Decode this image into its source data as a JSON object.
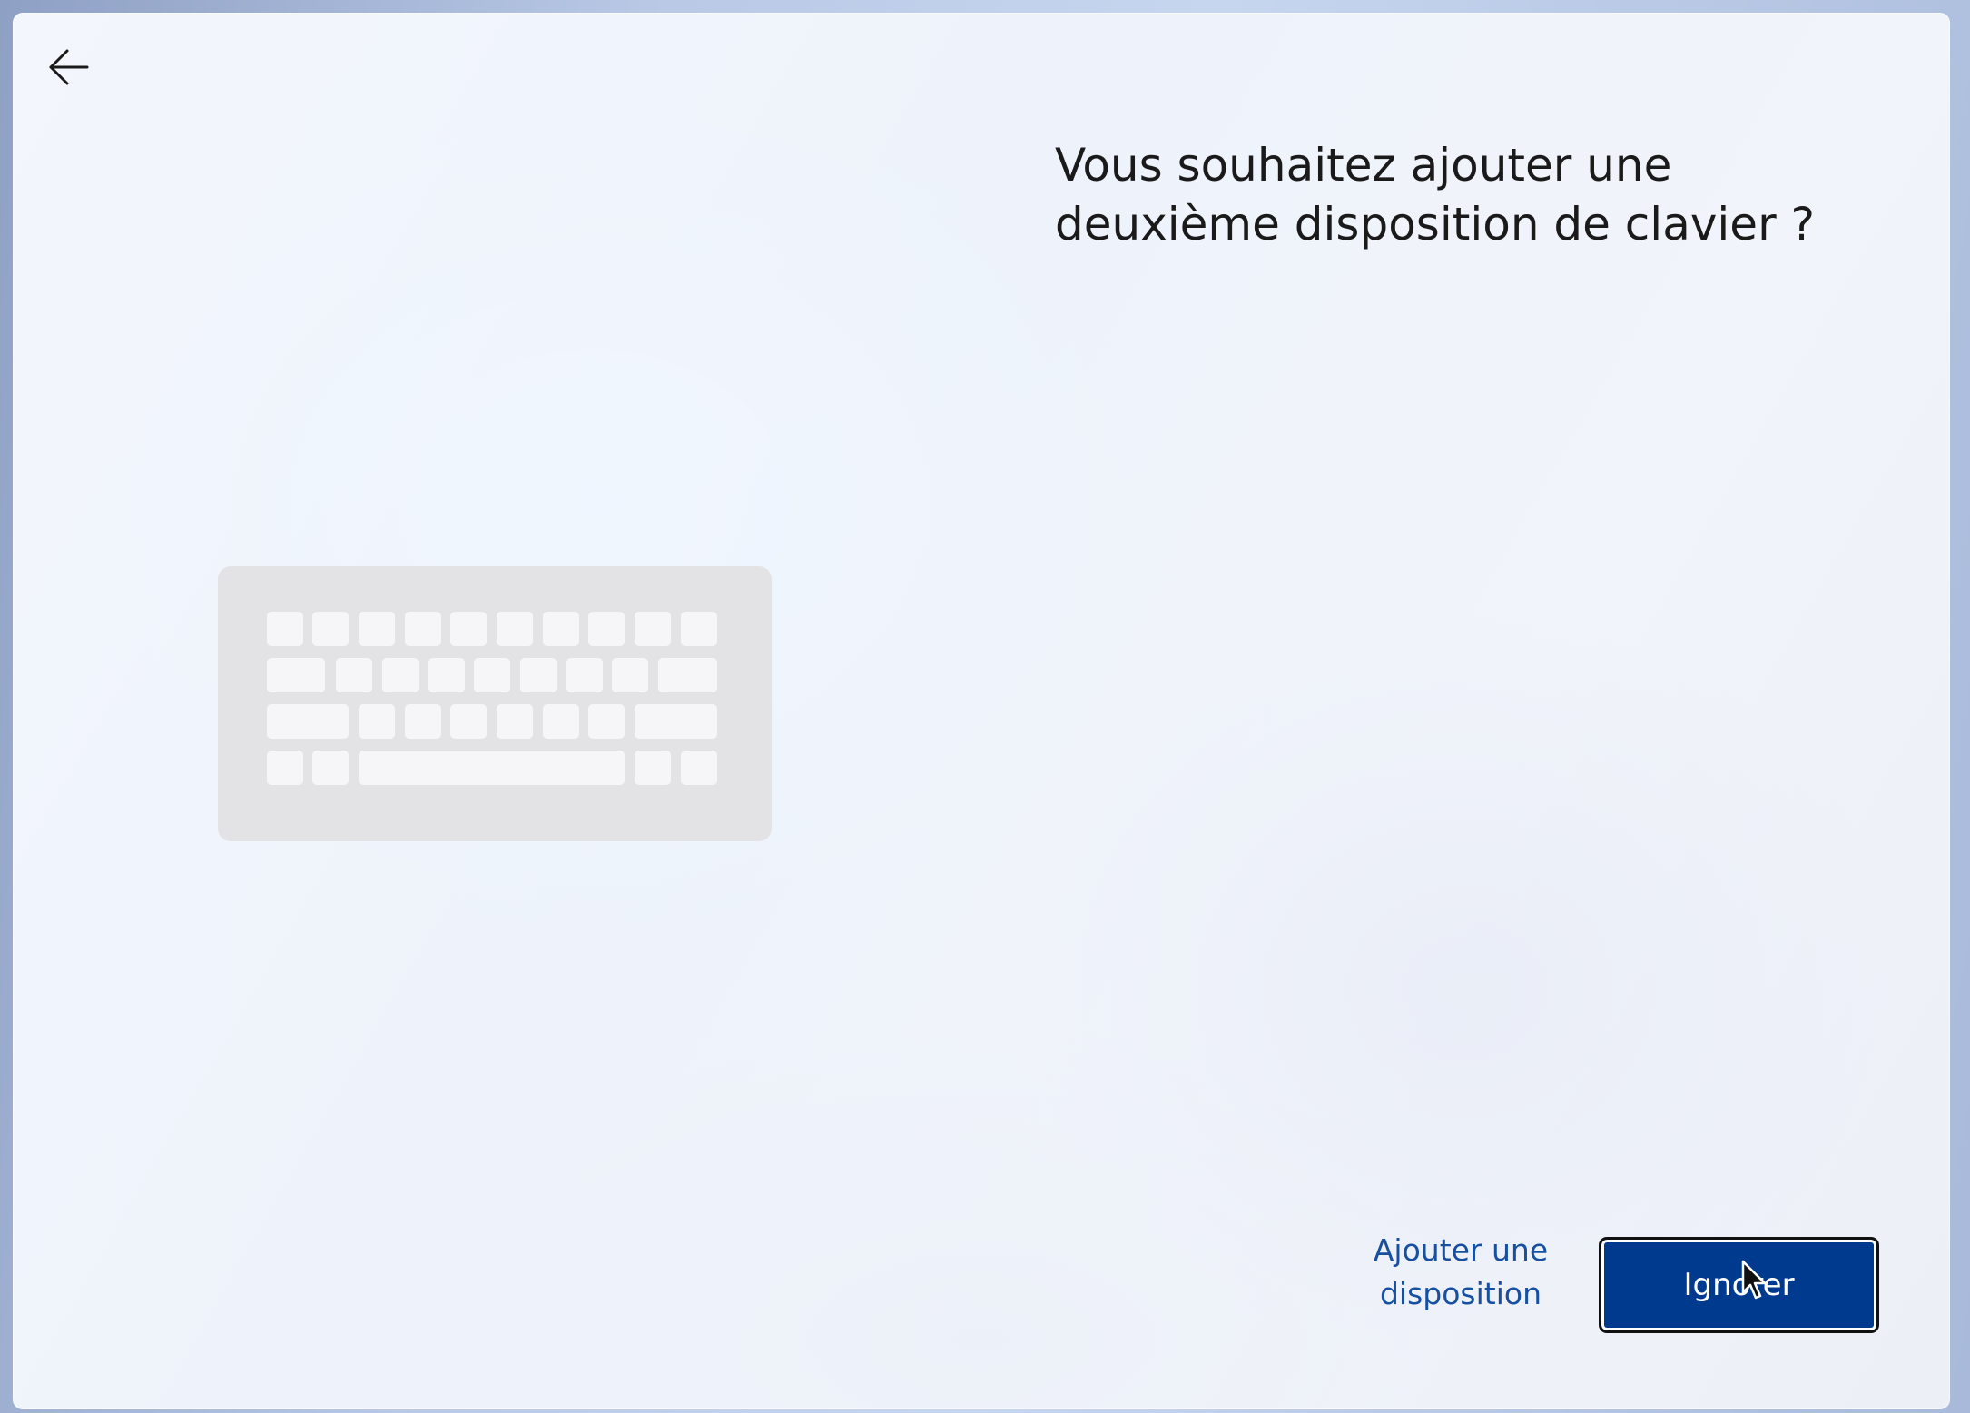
{
  "window": {
    "title_text": "Vous souhaitez ajouter une deuxième disposition de clavier ?"
  },
  "navigation": {
    "back_icon": "arrow-left-icon"
  },
  "illustration": {
    "icon": "keyboard-icon"
  },
  "actions": {
    "add_layout_label": "Ajouter une disposition",
    "skip_label": "Ignorer"
  },
  "colors": {
    "primary_button": "#003a8f",
    "link": "#1750a0",
    "text": "#1a1a1a",
    "keyboard_body": "#e3e3e6",
    "keyboard_key": "#f6f6f8"
  }
}
